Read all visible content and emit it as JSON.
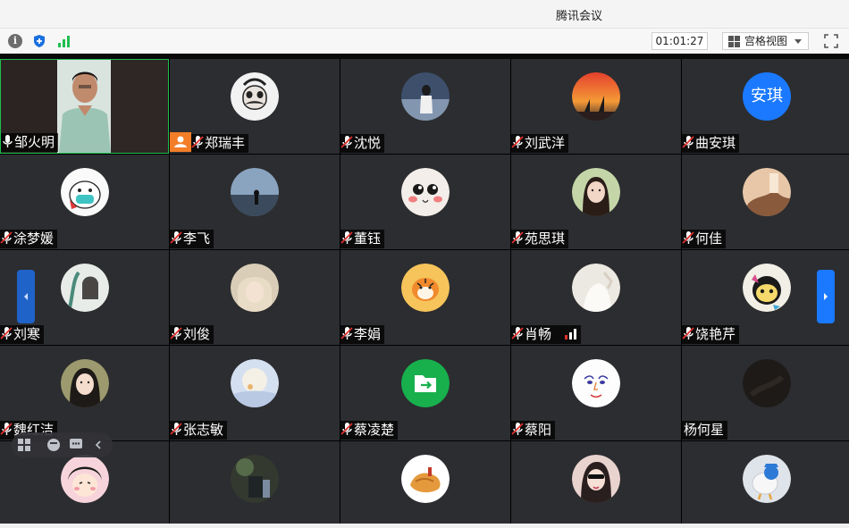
{
  "window": {
    "title": "腾讯会议"
  },
  "toolbar": {
    "timer": "01:01:27",
    "view_label": "宫格视图"
  },
  "participants": [
    {
      "name": "邹火明"
    },
    {
      "name": "郑瑞丰"
    },
    {
      "name": "沈悦"
    },
    {
      "name": "刘武洋"
    },
    {
      "name": "曲安琪"
    },
    {
      "name": "涂梦媛"
    },
    {
      "name": "李飞"
    },
    {
      "name": "董钰"
    },
    {
      "name": "苑思琪"
    },
    {
      "name": "何佳"
    },
    {
      "name": "刘寒"
    },
    {
      "name": "刘俊"
    },
    {
      "name": "李娟"
    },
    {
      "name": "肖畅"
    },
    {
      "name": "饶艳芹"
    },
    {
      "name": "魏红洁"
    },
    {
      "name": "张志敏"
    },
    {
      "name": "蔡凌楚"
    },
    {
      "name": "蔡阳"
    },
    {
      "name": "杨何星"
    }
  ],
  "avatar_text": {
    "qu_anqi": "安琪"
  },
  "colors": {
    "accent": "#1a79ff",
    "active_border": "#1fbf4e",
    "tile_bg": "#2c2d30",
    "host_badge": "#f47d27"
  }
}
